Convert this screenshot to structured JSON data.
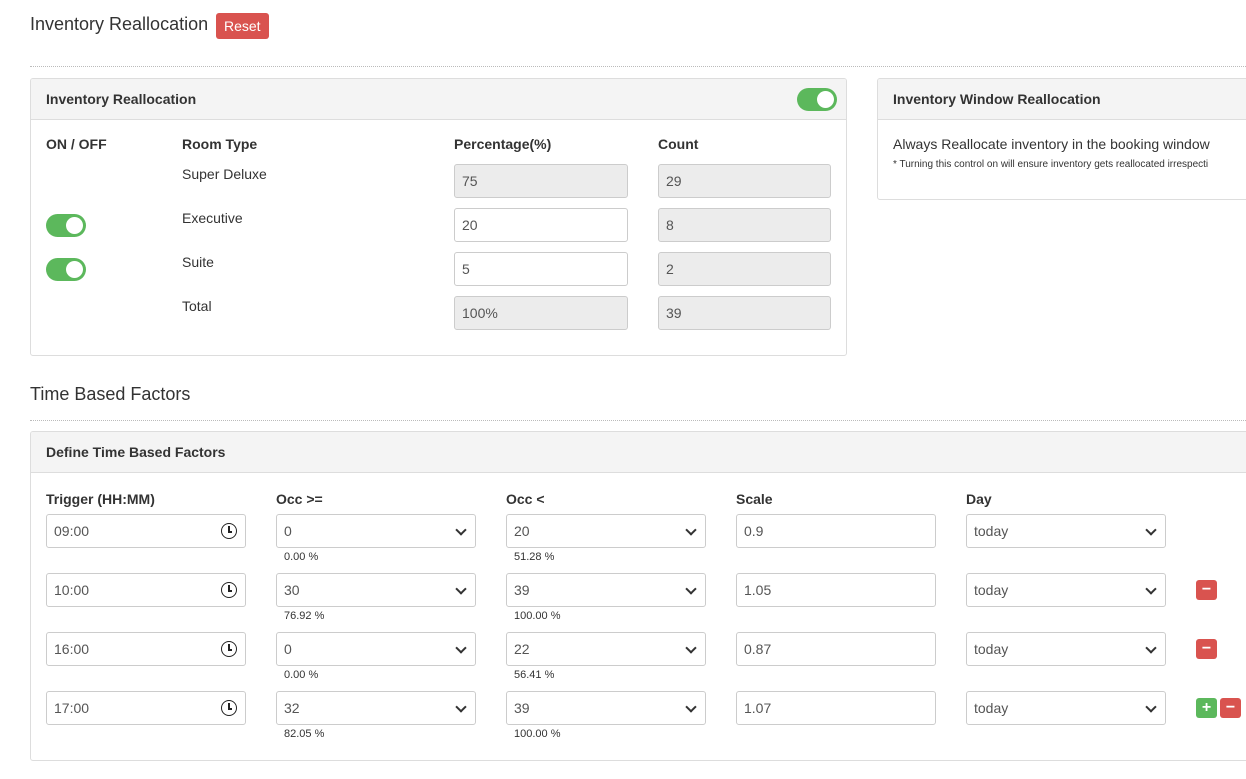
{
  "page": {
    "title": "Inventory Reallocation",
    "reset_label": "Reset",
    "section2_title": "Time Based Factors"
  },
  "inventory": {
    "header": "Inventory Reallocation",
    "enabled": true,
    "columns": {
      "onoff": "ON / OFF",
      "room_type": "Room Type",
      "percentage": "Percentage(%)",
      "count": "Count"
    },
    "rows": [
      {
        "room_type": "Super Deluxe",
        "toggle": null,
        "percentage": "75",
        "count": "29",
        "pct_readonly": true
      },
      {
        "room_type": "Executive",
        "toggle": true,
        "percentage": "20",
        "count": "8",
        "pct_readonly": false
      },
      {
        "room_type": "Suite",
        "toggle": true,
        "percentage": "5",
        "count": "2",
        "pct_readonly": false
      },
      {
        "room_type": "Total",
        "toggle": null,
        "percentage": "100%",
        "count": "39",
        "pct_readonly": true
      }
    ]
  },
  "window": {
    "header": "Inventory Window Reallocation",
    "text": "Always Reallocate inventory in the booking window",
    "note": "* Turning this control on will ensure inventory gets reallocated irrespecti"
  },
  "factors": {
    "header": "Define Time Based Factors",
    "columns": {
      "trigger": "Trigger (HH:MM)",
      "occ_ge": "Occ >=",
      "occ_lt": "Occ <",
      "scale": "Scale",
      "day": "Day"
    },
    "rows": [
      {
        "trigger": "09:00",
        "occ_ge": "0",
        "occ_ge_pct": "0.00 %",
        "occ_lt": "20",
        "occ_lt_pct": "51.28 %",
        "scale": "0.9",
        "day": "today",
        "remove": false,
        "add": false
      },
      {
        "trigger": "10:00",
        "occ_ge": "30",
        "occ_ge_pct": "76.92 %",
        "occ_lt": "39",
        "occ_lt_pct": "100.00 %",
        "scale": "1.05",
        "day": "today",
        "remove": true,
        "add": false
      },
      {
        "trigger": "16:00",
        "occ_ge": "0",
        "occ_ge_pct": "0.00 %",
        "occ_lt": "22",
        "occ_lt_pct": "56.41 %",
        "scale": "0.87",
        "day": "today",
        "remove": true,
        "add": false
      },
      {
        "trigger": "17:00",
        "occ_ge": "32",
        "occ_ge_pct": "82.05 %",
        "occ_lt": "39",
        "occ_lt_pct": "100.00 %",
        "scale": "1.07",
        "day": "today",
        "remove": true,
        "add": true
      }
    ]
  },
  "colors": {
    "danger": "#d9534f",
    "success": "#5cb85c"
  }
}
